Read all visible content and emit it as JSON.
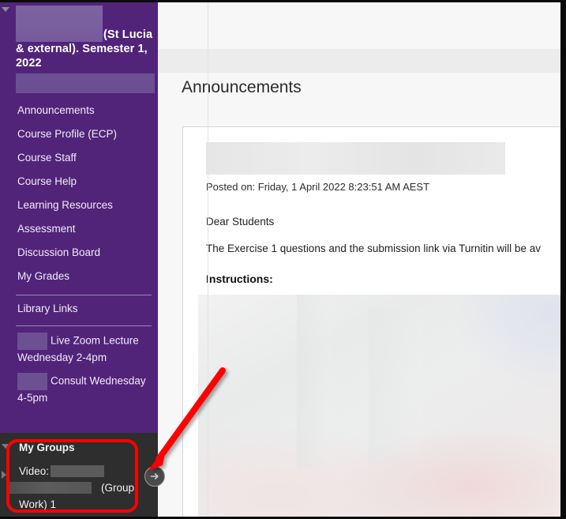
{
  "window": {
    "border_color": "#0a0a0a"
  },
  "sidebar": {
    "accent_color": "#51247a",
    "course_title_suffix": "(St Lucia & external). Semester 1, 2022",
    "redacted_course_name": "",
    "redacted_nav_item": "",
    "collapse_icon": "triangle-down-icon",
    "items": [
      {
        "label": "Announcements"
      },
      {
        "label": "Course Profile (ECP)"
      },
      {
        "label": "Course Staff"
      },
      {
        "label": "Course Help"
      },
      {
        "label": "Learning Resources"
      },
      {
        "label": "Assessment"
      },
      {
        "label": "Discussion Board"
      },
      {
        "label": "My Grades"
      }
    ],
    "library_links": {
      "label": "Library Links"
    },
    "zoom_links": [
      {
        "label": "Live Zoom Lecture Wednesday 2-4pm"
      },
      {
        "label": "Consult Wednesday 4-5pm"
      }
    ]
  },
  "groups": {
    "panel_background": "#2e2e2e",
    "title": "My Groups",
    "video_label": "Video:",
    "group_suffix": "(Group Work) 1",
    "redacted_name_1": "",
    "redacted_name_2": "",
    "highlight_color": "#ff0000",
    "expand_handle_icon": "arrow-right-circle-icon",
    "expand_handle_glyph": "→"
  },
  "annotation": {
    "arrow_color": "#ff0000",
    "arrow_icon": "red-arrow-icon",
    "points_to": "expand-handle"
  },
  "main": {
    "background": "#f7f7f7",
    "page_title": "Announcements",
    "announcement": {
      "redacted_subject": "",
      "posted_on": "Posted on: Friday, 1 April 2022 8:23:51 AM AEST",
      "greeting": "Dear Students",
      "body": "The Exercise 1 questions and the submission link via Turnitin will be av",
      "instructions_heading": "Instructions:",
      "redacted_image": ""
    }
  }
}
